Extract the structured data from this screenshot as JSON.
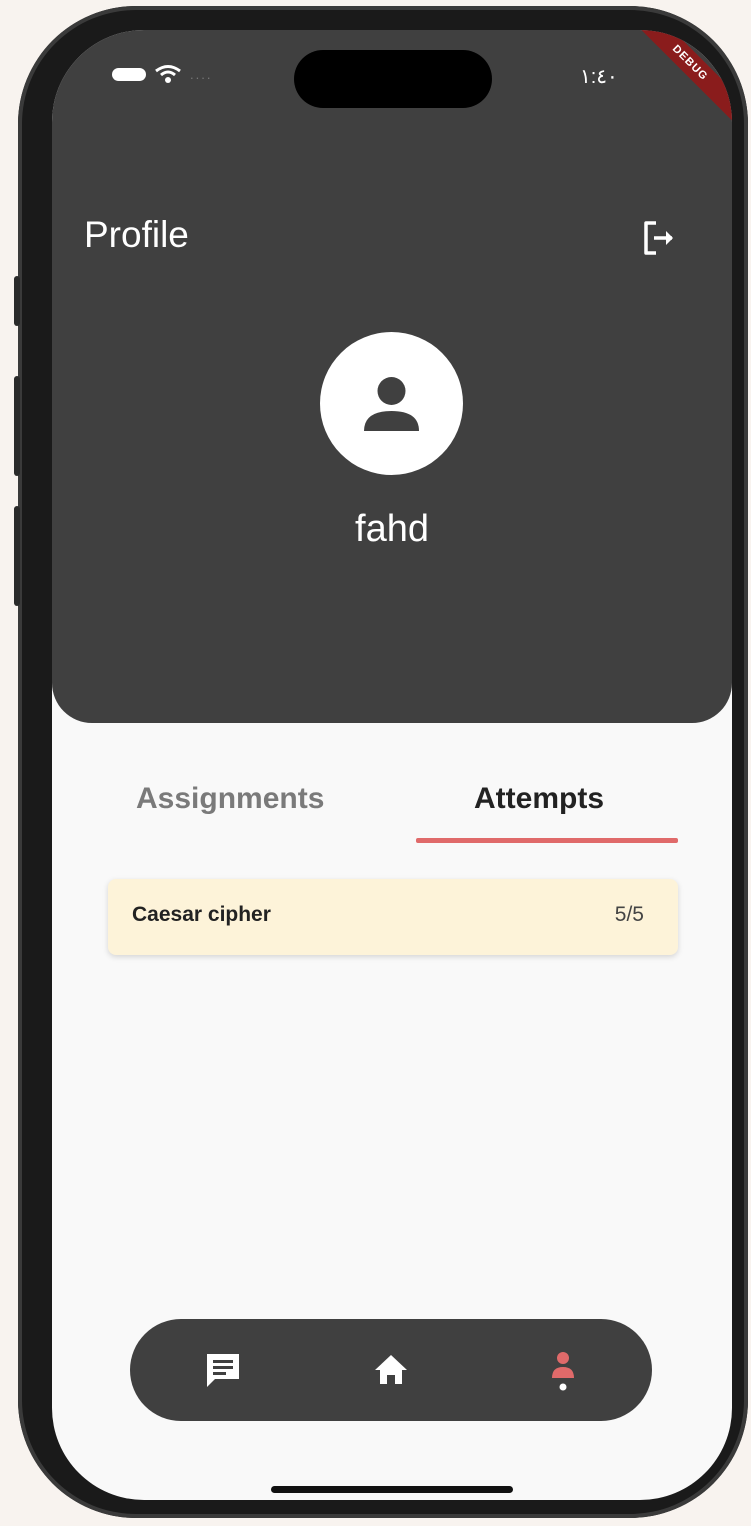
{
  "status_bar": {
    "time": "١:٤٠",
    "signal_dots": "....",
    "debug_banner": "DEBUG"
  },
  "header": {
    "title": "Profile",
    "logout_icon": "logout-icon",
    "avatar_icon": "person-icon",
    "username": "fahd"
  },
  "tabs": [
    {
      "label": "Assignments",
      "active": false
    },
    {
      "label": "Attempts",
      "active": true
    }
  ],
  "attempts": [
    {
      "title": "Caesar cipher",
      "score": "5/5"
    }
  ],
  "bottom_nav": [
    {
      "icon": "chat-icon",
      "active": false
    },
    {
      "icon": "home-icon",
      "active": false
    },
    {
      "icon": "profile-icon",
      "active": true
    }
  ],
  "colors": {
    "header_bg": "#404040",
    "accent": "#e06a6a",
    "card_bg": "#fdf3d9",
    "screen_bg": "#f9f9f9"
  }
}
